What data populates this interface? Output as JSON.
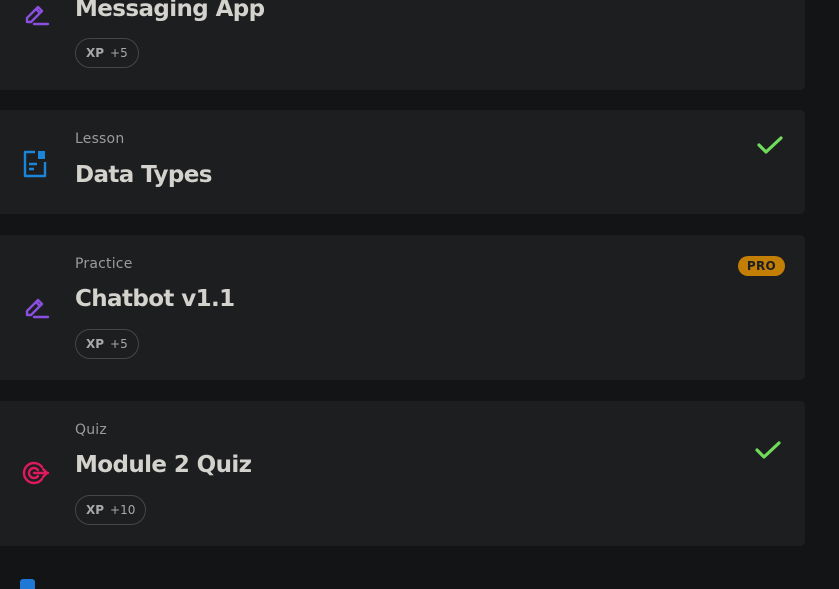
{
  "colors": {
    "page_bg": "#131416",
    "card_bg": "#1d1e20",
    "practice_icon": "#8a4fe0",
    "lesson_icon": "#1b86d9",
    "quiz_icon": "#e0195f",
    "check": "#6fdc5a",
    "pro_badge": "#c27e05"
  },
  "items": [
    {
      "kind": "",
      "title": "Messaging App",
      "icon": "pencil-icon",
      "xp_label": "XP",
      "xp_points": "+5",
      "completed": false,
      "pro": false
    },
    {
      "kind": "Lesson",
      "title": "Data Types",
      "icon": "document-icon",
      "completed": true,
      "pro": false
    },
    {
      "kind": "Practice",
      "title": "Chatbot v1.1",
      "icon": "pencil-icon",
      "xp_label": "XP",
      "xp_points": "+5",
      "completed": false,
      "pro": true,
      "pro_label": "PRO"
    },
    {
      "kind": "Quiz",
      "title": "Module 2 Quiz",
      "icon": "target-icon",
      "xp_label": "XP",
      "xp_points": "+10",
      "completed": true,
      "pro": false
    }
  ]
}
